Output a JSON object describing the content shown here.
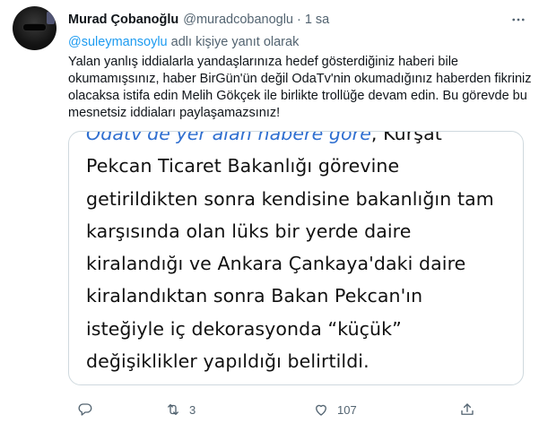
{
  "tweet": {
    "author_name": "Murad Çobanoğlu",
    "author_handle": "@muradcobanoglu",
    "separator": "·",
    "timestamp": "1 sa",
    "reply_mention": "@suleymansoylu",
    "reply_suffix": " adlı kişiye yanıt olarak",
    "text": "Yalan yanlış iddialarla yandaşlarınıza hedef gösterdiğiniz haberi bile okumamışsınız, haber BirGün'ün değil OdaTv'nin okumadığınız haberden fikriniz olacaksa istifa edin Melih Gökçek ile birlikte trollüğe devam edin. Bu görevde bu mesnetsiz iddiaları paylaşamazsınız!",
    "image_lines": {
      "line0_blue": "Odatv'de yer alan habere göre",
      "line0_black": ", Kurşat",
      "line1": "Pekcan Ticaret Bakanlığı görevine",
      "line2": "getirildikten sonra kendisine bakanlığın tam",
      "line3": "karşısında olan lüks bir yerde daire",
      "line4": "kiralandığı ve Ankara Çankaya'daki daire",
      "line5": "kiralandıktan sonra Bakan Pekcan'ın",
      "line6": "isteğiyle iç dekorasyonda “küçük”",
      "line7": "değişiklikler yapıldığı belirtildi."
    },
    "actions": {
      "reply_count": "",
      "retweet_count": "3",
      "like_count": "107"
    }
  },
  "icons": {
    "more": "more-horizontal-icon",
    "reply": "reply-icon",
    "retweet": "retweet-icon",
    "like": "heart-icon",
    "share": "share-icon"
  },
  "colors": {
    "accent": "#1d9bf0",
    "secondary_text": "#536471",
    "primary_text": "#0f1419",
    "border": "#cfd9de"
  }
}
